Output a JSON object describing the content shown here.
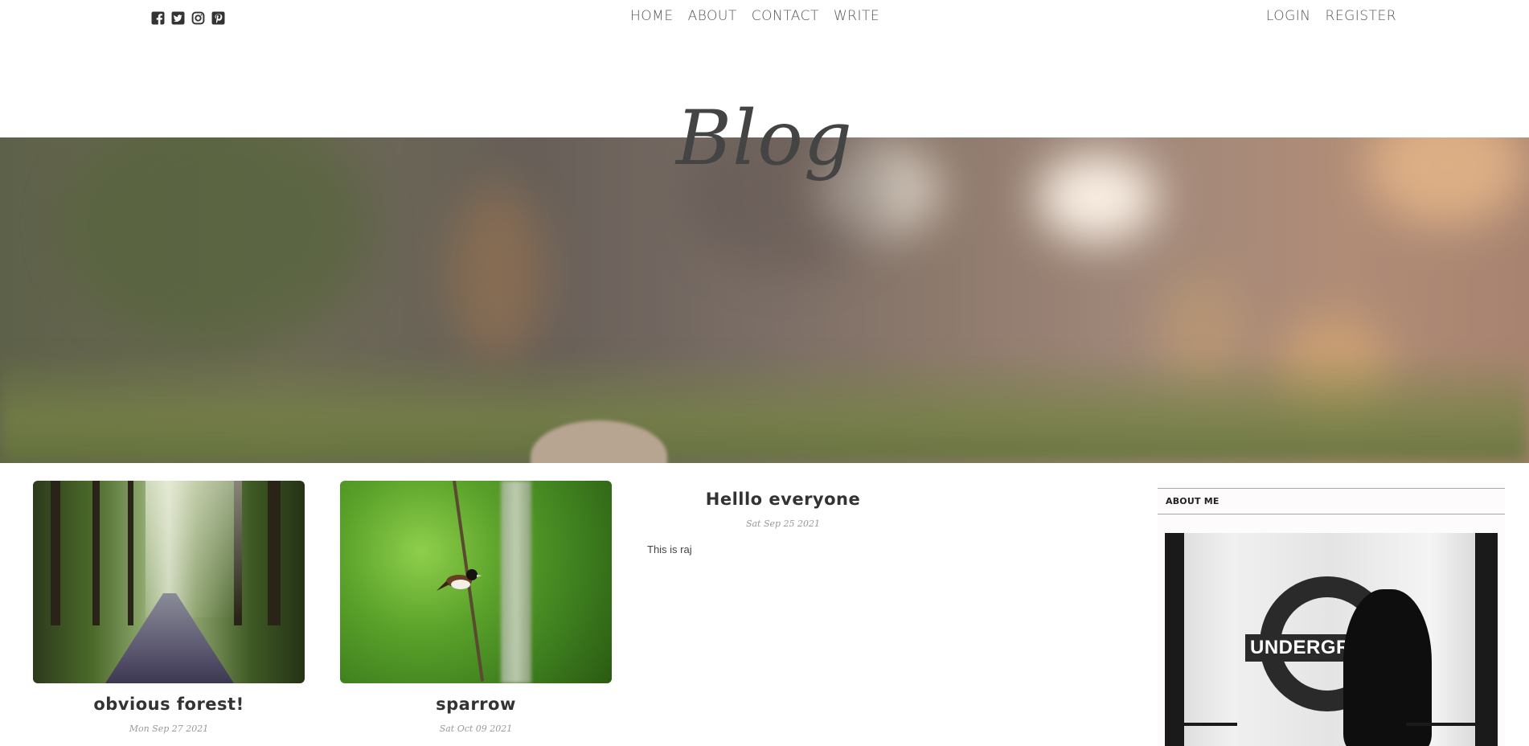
{
  "nav": {
    "links": [
      "HOME",
      "ABOUT",
      "CONTACT",
      "WRITE"
    ],
    "auth": [
      "LOGIN",
      "REGISTER"
    ],
    "social_icons": [
      "facebook-icon",
      "twitter-icon",
      "instagram-icon",
      "pinterest-icon"
    ]
  },
  "header": {
    "title": "Blog"
  },
  "posts": [
    {
      "title": "obvious forest!",
      "date": "Mon Sep 27 2021"
    },
    {
      "title": "sparrow",
      "date": "Sat Oct 09 2021"
    },
    {
      "title": "Helllo everyone",
      "date": "Sat Sep 25 2021",
      "body": "This is raj"
    }
  ],
  "sidebar": {
    "title": "ABOUT ME",
    "image_sign_text": "UNDERGR"
  },
  "colors": {
    "text": "#444444",
    "muted": "#999999",
    "sidebar_bg": "#fdfbfb"
  }
}
